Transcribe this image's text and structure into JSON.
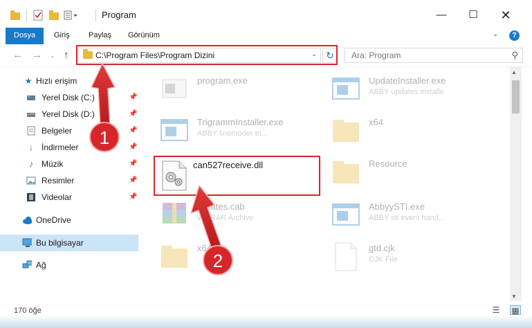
{
  "window": {
    "title": "Program"
  },
  "ribbon": {
    "tabs": [
      {
        "label": "Dosya"
      },
      {
        "label": "Giriş"
      },
      {
        "label": "Paylaş"
      },
      {
        "label": "Görünüm"
      }
    ],
    "help_label": "?"
  },
  "address": {
    "path": "C:\\Program Files\\Program Dizini",
    "search_placeholder": "Ara: Program"
  },
  "sidebar": {
    "quick_access": "Hızlı erişim",
    "items": [
      {
        "label": "Yerel Disk (C:)",
        "icon": "drive-icon",
        "pinned": true
      },
      {
        "label": "Yerel Disk (D:)",
        "icon": "drive-icon",
        "pinned": true
      },
      {
        "label": "Belgeler",
        "icon": "documents-icon",
        "pinned": true
      },
      {
        "label": "İndirmeler",
        "icon": "download-icon",
        "pinned": true
      },
      {
        "label": "Müzik",
        "icon": "music-icon",
        "pinned": true
      },
      {
        "label": "Resimler",
        "icon": "pictures-icon",
        "pinned": true
      },
      {
        "label": "Videolar",
        "icon": "video-icon",
        "pinned": true
      }
    ],
    "onedrive": "OneDrive",
    "this_pc": "Bu bilgisayar",
    "network": "Ağ"
  },
  "files": [
    {
      "name": "program.exe",
      "sub": "",
      "icon": "exe-icon",
      "faded": true
    },
    {
      "name": "UpdateInstaller.exe",
      "sub": "ABBY updates installe",
      "icon": "exe-icon",
      "faded": true
    },
    {
      "name": "TrigrammInstaller.exe",
      "sub": "ABBY linemoder tri...",
      "icon": "exe-icon",
      "faded": true
    },
    {
      "name": "x64",
      "sub": "",
      "icon": "folder-icon",
      "faded": true
    },
    {
      "name": "can527receive.dll",
      "sub": "",
      "icon": "dll-icon",
      "faded": false
    },
    {
      "name": "Resource",
      "sub": "",
      "icon": "folder-icon",
      "faded": true
    },
    {
      "name": "tificates.cab",
      "sub": "WinRAR Archive",
      "icon": "archive-icon",
      "faded": true
    },
    {
      "name": "AbbyySTI.exe",
      "sub": "ABBY sti event hand...",
      "icon": "exe-icon",
      "faded": true
    },
    {
      "name": "x64",
      "sub": "",
      "icon": "folder-icon",
      "faded": true
    },
    {
      "name": "gtd.cjk",
      "sub": "CJK File",
      "icon": "file-icon",
      "faded": true
    }
  ],
  "status": {
    "count": "170 öğe"
  },
  "annotations": {
    "step1": "1",
    "step2": "2",
    "color": "#d6262a"
  }
}
